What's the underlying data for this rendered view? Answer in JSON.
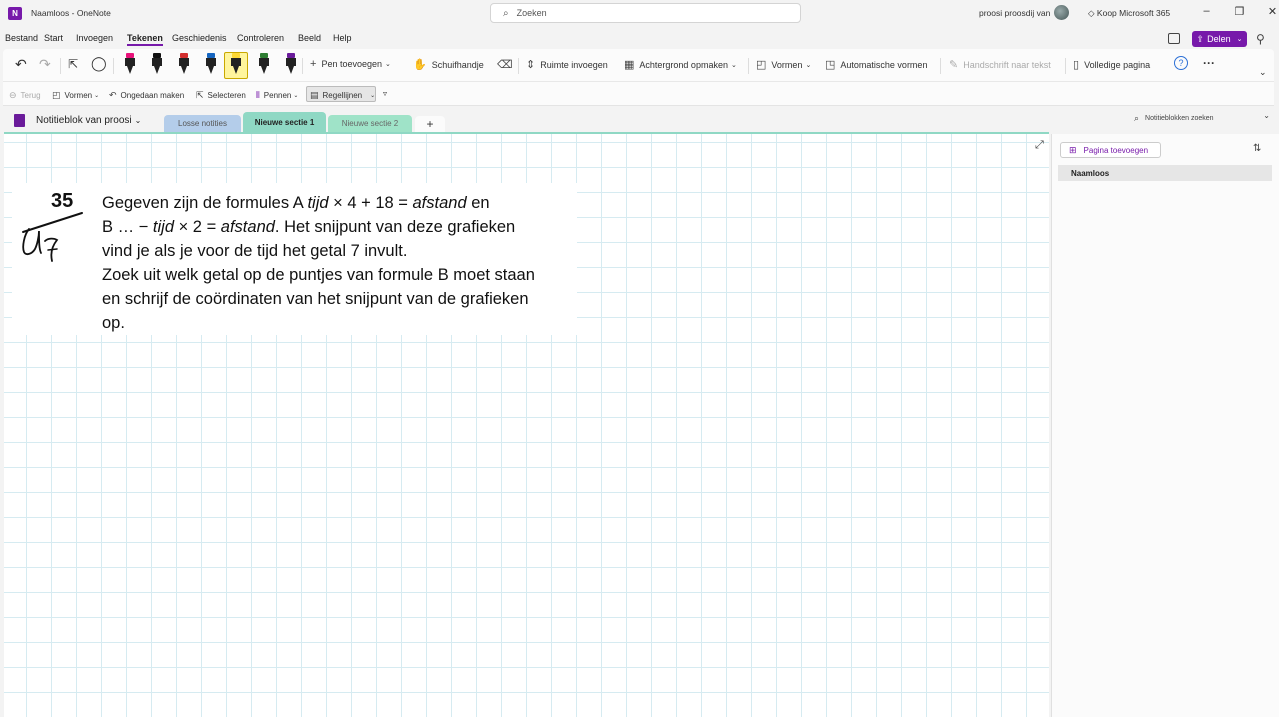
{
  "titlebar": {
    "logo_letter": "N",
    "title": "Naamloos - OneNote",
    "search_placeholder": "Zoeken",
    "user": "proosi proosdij van",
    "koop": "Koop Microsoft 365",
    "minimize": "–",
    "restore": "❐",
    "close": "✕"
  },
  "menu": {
    "items": [
      "Bestand",
      "Start",
      "Invoegen",
      "Tekenen",
      "Geschiedenis",
      "Controleren",
      "Beeld",
      "Help"
    ],
    "active": "Tekenen",
    "share_label": "Delen"
  },
  "ribbon": {
    "undo": "↶",
    "redo": "↷",
    "add_pen": "Pen toevoegen",
    "hand": "Schuifhandje",
    "insert_space": "Ruimte invoegen",
    "background": "Achtergrond opmaken",
    "shapes": "Vormen",
    "auto_shapes": "Automatische vormen",
    "ink_to_text": "Handschrift naar tekst",
    "full_page": "Volledige pagina",
    "help": "?",
    "more": "···",
    "pen_colors": [
      "#e8117a",
      "#111111",
      "#d32f2f",
      "#1565c0",
      "#fdd835",
      "#2e7d32",
      "#6a1b9a"
    ]
  },
  "subribbon": {
    "back": "Terug",
    "shapes": "Vormen",
    "undo": "Ongedaan maken",
    "select": "Selecteren",
    "pens": "Pennen",
    "rule_lines": "Regellijnen"
  },
  "notebook": {
    "name": "Notitieblok van proosi",
    "tabs": [
      "Losse notities",
      "Nieuwe sectie 1",
      "Nieuwe sectie 2"
    ],
    "active_tab": "Nieuwe sectie 1",
    "add_tab": "+",
    "search_placeholder": "Notitieblokken zoeken"
  },
  "exercise": {
    "number": "35",
    "line1_a": "Gegeven zijn de formules A ",
    "line1_i1": "tijd",
    "line1_b": " × 4 + 18 = ",
    "line1_i2": "afstand",
    "line1_c": " en",
    "line2_a": "B … − ",
    "line2_i1": "tijd",
    "line2_b": " × 2 = ",
    "line2_i2": "afstand",
    "line2_c": ". Het snijpunt van deze grafieken",
    "line3": "vind je als je voor de tijd het getal 7 invult.",
    "line4": "Zoek uit welk getal op de puntjes van formule B moet staan",
    "line5": "en schrijf de coördinaten van het snijpunt van de grafieken",
    "line6": "op."
  },
  "pages": {
    "add_label": "Pagina toevoegen",
    "items": [
      "Naamloos"
    ]
  }
}
